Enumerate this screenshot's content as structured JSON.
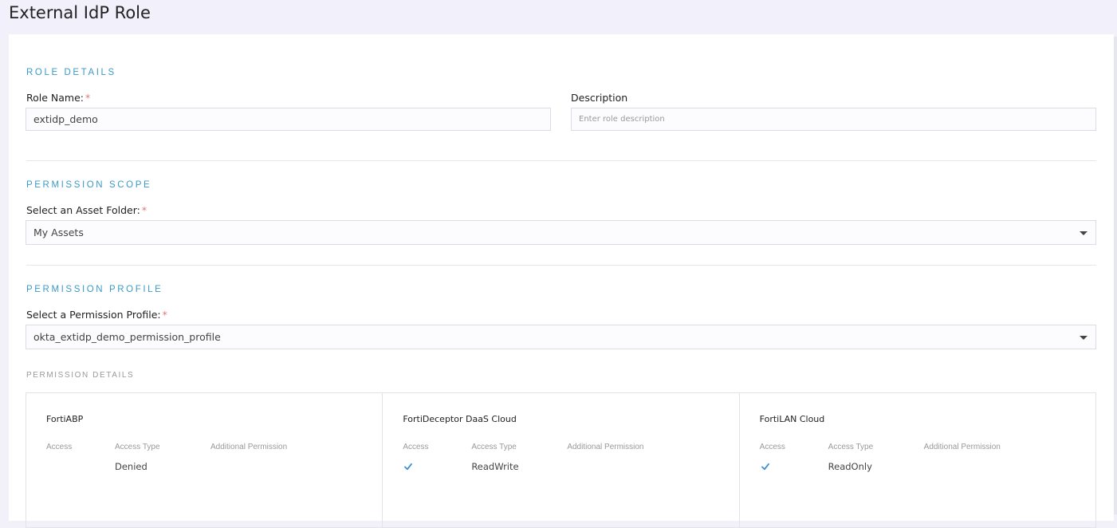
{
  "page": {
    "title": "External IdP Role"
  },
  "role_details": {
    "section_title": "ROLE DETAILS",
    "role_name_label": "Role Name:",
    "required_mark": "*",
    "role_name_value": "extidp_demo",
    "description_label": "Description",
    "description_placeholder": "Enter role description"
  },
  "permission_scope": {
    "section_title": "PERMISSION SCOPE",
    "asset_folder_label": "Select an Asset Folder:",
    "asset_folder_value": "My Assets"
  },
  "permission_profile": {
    "section_title": "PERMISSION PROFILE",
    "profile_label": "Select a Permission Profile:",
    "profile_value": "okta_extidp_demo_permission_profile"
  },
  "permission_details": {
    "title": "PERMISSION DETAILS",
    "columns": [
      "Access",
      "Access Type",
      "Additional Permission"
    ],
    "products": [
      {
        "name": "FortiABP",
        "access_icon": "",
        "access_type": "Denied",
        "additional": ""
      },
      {
        "name": "FortiDeceptor DaaS Cloud",
        "access_icon": "check-icon",
        "access_type": "ReadWrite",
        "additional": ""
      },
      {
        "name": "FortiLAN Cloud",
        "access_icon": "check-icon",
        "access_type": "ReadOnly",
        "additional": ""
      }
    ]
  },
  "colors": {
    "accent": "#3b9ac6",
    "check": "#3b8fd6",
    "required": "#e07878"
  }
}
